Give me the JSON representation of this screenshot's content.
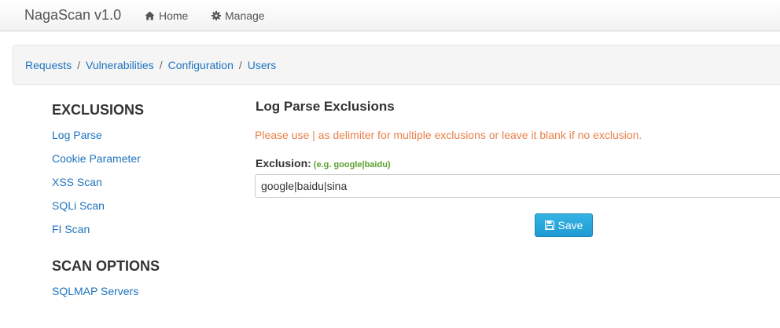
{
  "navbar": {
    "brand": "NagaScan v1.0",
    "items": [
      {
        "label": "Home",
        "icon": "home-icon"
      },
      {
        "label": "Manage",
        "icon": "gear-icon"
      }
    ]
  },
  "breadcrumb": {
    "items": [
      "Requests",
      "Vulnerabilities",
      "Configuration",
      "Users"
    ],
    "separator": "/"
  },
  "sidebar": {
    "sections": [
      {
        "heading": "EXCLUSIONS",
        "items": [
          "Log Parse",
          "Cookie Parameter",
          "XSS Scan",
          "SQLi Scan",
          "FI Scan"
        ]
      },
      {
        "heading": "SCAN OPTIONS",
        "items": [
          "SQLMAP Servers"
        ]
      }
    ]
  },
  "main": {
    "title": "Log Parse Exclusions",
    "notice": "Please use | as delimiter for multiple exclusions or leave it blank if no exclusion.",
    "field": {
      "label": "Exclusion:",
      "hint": "(e.g. google|baidu)",
      "value": "google|baidu|sina"
    },
    "save_label": "Save",
    "save_icon": "floppy-disk-icon"
  },
  "colors": {
    "link": "#1e73be",
    "notice": "#e8804a",
    "hint": "#5ba02c",
    "button": "#1e9bd2"
  }
}
